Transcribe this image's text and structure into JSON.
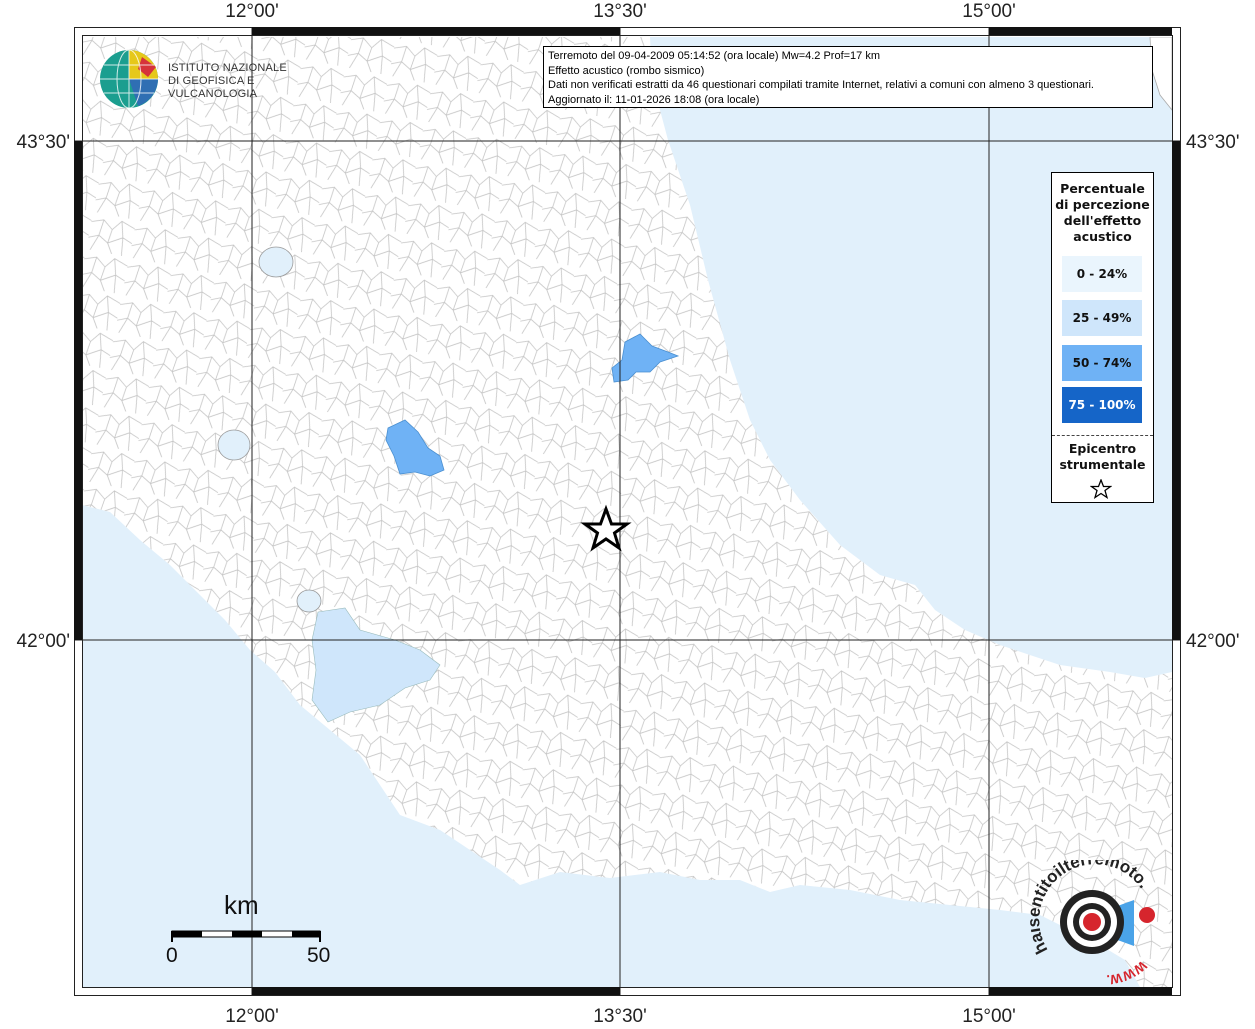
{
  "info": {
    "line1": "Terremoto del 09-04-2009 05:14:52 (ora locale) Mw=4.2 Prof=17 km",
    "line2": "Effetto acustico (rombo sismico)",
    "line3": "Dati non verificati estratti da 46 questionari compilati tramite Internet, relativi a comuni con almeno 3 questionari.",
    "line4": "Aggiornato il: 11-01-2026 18:08 (ora locale)"
  },
  "logo_ingv": {
    "line1": "ISTITUTO NAZIONALE",
    "line2": "DI GEOFISICA E VULCANOLOGIA"
  },
  "axis": {
    "top": [
      "12°00'",
      "13°30'",
      "15°00'"
    ],
    "bottom": [
      "12°00'",
      "13°30'",
      "15°00'"
    ],
    "left": [
      "43°30'",
      "42°00'"
    ],
    "right": [
      "43°30'",
      "42°00'"
    ]
  },
  "legend": {
    "title_lines": [
      "Percentuale",
      "di percezione",
      "dell'effetto",
      "acustico"
    ],
    "items": [
      {
        "label": "0 - 24%",
        "color": "#eaf5fd",
        "text_color": "#111111"
      },
      {
        "label": "25 - 49%",
        "color": "#cfe6fb",
        "text_color": "#111111"
      },
      {
        "label": "50 - 74%",
        "color": "#6fb2f5",
        "text_color": "#111111"
      },
      {
        "label": "75 - 100%",
        "color": "#1565c8",
        "text_color": "#ffffff"
      }
    ],
    "epicenter_lines": [
      "Epicentro",
      "strumentale"
    ]
  },
  "scale": {
    "title": "km",
    "min": "0",
    "max": "50"
  },
  "hst_logo": {
    "text": "haisentitoilterremoto.it",
    "url": "WWW."
  },
  "colors": {
    "sea": "#e1f0fb",
    "land": "#ffffff",
    "border": "#bbbbbb",
    "grid": "#222222",
    "pct_25_49": "#cfe6fb",
    "pct_50_74": "#6fb2f5"
  }
}
